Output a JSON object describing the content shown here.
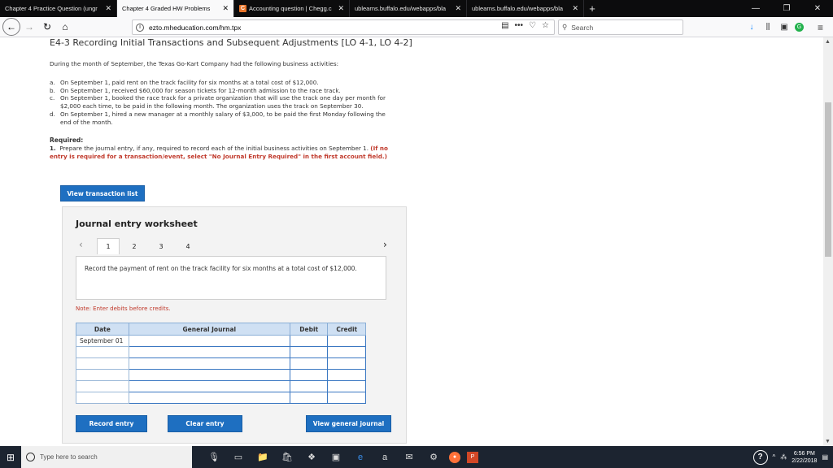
{
  "browser": {
    "tabs": [
      {
        "label": "Chapter 4 Practice Question (ungr",
        "active": false
      },
      {
        "label": "Chapter 4 Graded HW Problems",
        "active": true
      },
      {
        "label": "Accounting question | Chegg.c",
        "active": false,
        "favicon": "C"
      },
      {
        "label": "ublearns.buffalo.edu/webapps/bla",
        "active": false
      },
      {
        "label": "ublearns.buffalo.edu/webapps/bla",
        "active": false
      }
    ],
    "url": "ezto.mheducation.com/hm.tpx",
    "search_placeholder": "Search"
  },
  "page": {
    "title": "E4-3 Recording Initial Transactions and Subsequent Adjustments [LO 4-1, LO 4-2]",
    "intro": "During the month of September, the Texas Go-Kart Company had the following business activities:",
    "activities": [
      {
        "letter": "a.",
        "text": "On September 1, paid rent on the track facility for six months at a total cost of $12,000."
      },
      {
        "letter": "b.",
        "text": "On September 1, received $60,000 for season tickets for 12-month admission to the race track."
      },
      {
        "letter": "c.",
        "text": "On September 1, booked the race track for a private organization that will use the track one day per month for $2,000 each time, to be paid in the following month. The organization uses the track on September 30."
      },
      {
        "letter": "d.",
        "text": "On September 1, hired a new manager at a monthly salary of $3,000, to be paid the first Monday following the end of the month."
      }
    ],
    "required_heading": "Required:",
    "required_num": "1.",
    "required_text": "Prepare the journal entry, if any, required to record each of the initial business activities on September 1.",
    "required_highlight": "(If no entry is required for a transaction/event, select \"No Journal Entry Required\" in the first account field.)",
    "view_transaction_label": "View transaction list"
  },
  "worksheet": {
    "title": "Journal entry worksheet",
    "pages": [
      "1",
      "2",
      "3",
      "4"
    ],
    "active_page": "1",
    "prompt": "Record the payment of rent on the track facility for six months at a total cost of $12,000.",
    "note": "Note: Enter debits before credits.",
    "columns": [
      "Date",
      "General Journal",
      "Debit",
      "Credit"
    ],
    "first_date": "September 01",
    "record_label": "Record entry",
    "clear_label": "Clear entry",
    "view_gj_label": "View general journal"
  },
  "taskbar": {
    "search_placeholder": "Type here to search",
    "time": "6:56 PM",
    "date": "2/22/2018"
  }
}
